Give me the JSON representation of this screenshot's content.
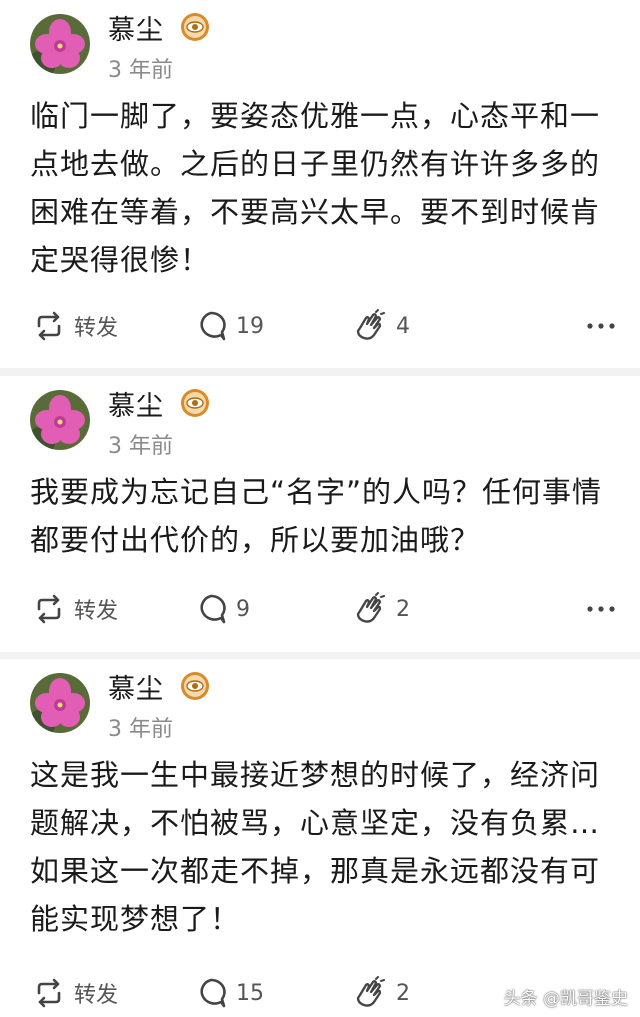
{
  "colors": {
    "page_bg": "#f2f2f2",
    "card_bg": "#ffffff",
    "text": "#1a1a1a",
    "muted": "#8a8a8a",
    "badge": "#d98a2b"
  },
  "posts": [
    {
      "author": "慕尘",
      "time": "3 年前",
      "content": "临门一脚了，要姿态优雅一点，心态平和一点地去做。之后的日子里仍然有许许多多的困难在等着，不要高兴太早。要不到时候肯定哭得很惨！",
      "repost_label": "转发",
      "comments": "19",
      "likes": "4"
    },
    {
      "author": "慕尘",
      "time": "3 年前",
      "content": "我要成为忘记自己“名字”的人吗？任何事情都要付出代价的，所以要加油哦？",
      "repost_label": "转发",
      "comments": "9",
      "likes": "2"
    },
    {
      "author": "慕尘",
      "time": "3 年前",
      "content": "这是我一生中最接近梦想的时候了，经济问题解决，不怕被骂，心意坚定，没有负累…如果这一次都走不掉，那真是永远都没有可能实现梦想了！",
      "repost_label": "转发",
      "comments": "15",
      "likes": "2"
    }
  ],
  "icons": {
    "avatar": "pink-azalea-flower",
    "badge": "eye-badge-icon",
    "repost": "repost-icon",
    "comment": "comment-bubble-icon",
    "like": "clap-hands-icon",
    "more": "more-dots-icon"
  },
  "watermark": "头条 @凯哥鉴史"
}
